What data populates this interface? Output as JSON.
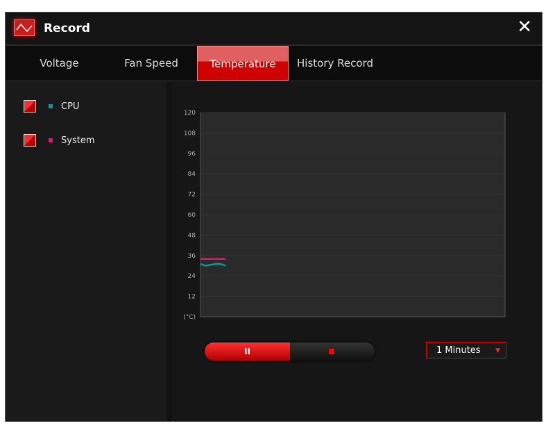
{
  "window": {
    "title": "Record",
    "close_icon": "close-icon"
  },
  "tabs": [
    {
      "label": "Voltage"
    },
    {
      "label": "Fan Speed"
    },
    {
      "label": "Temperature",
      "active": true
    },
    {
      "label": "History Record"
    }
  ],
  "legend": [
    {
      "label": "CPU",
      "color": "#0a9c94",
      "checked": true
    },
    {
      "label": "System",
      "color": "#e8117a",
      "checked": true
    }
  ],
  "chart_data": {
    "type": "line",
    "ylabel": "(°C)",
    "ylim": [
      0,
      120
    ],
    "yticks": [
      12,
      24,
      36,
      48,
      60,
      72,
      84,
      96,
      108,
      120
    ],
    "series": [
      {
        "name": "CPU",
        "color": "#0a9c94",
        "values": [
          31,
          30,
          30.5,
          31,
          31,
          30
        ]
      },
      {
        "name": "System",
        "color": "#e8117a",
        "values": [
          34,
          34,
          34,
          34,
          34,
          34
        ]
      }
    ]
  },
  "controls": {
    "pause_label": "II",
    "interval": "1 Minutes"
  }
}
